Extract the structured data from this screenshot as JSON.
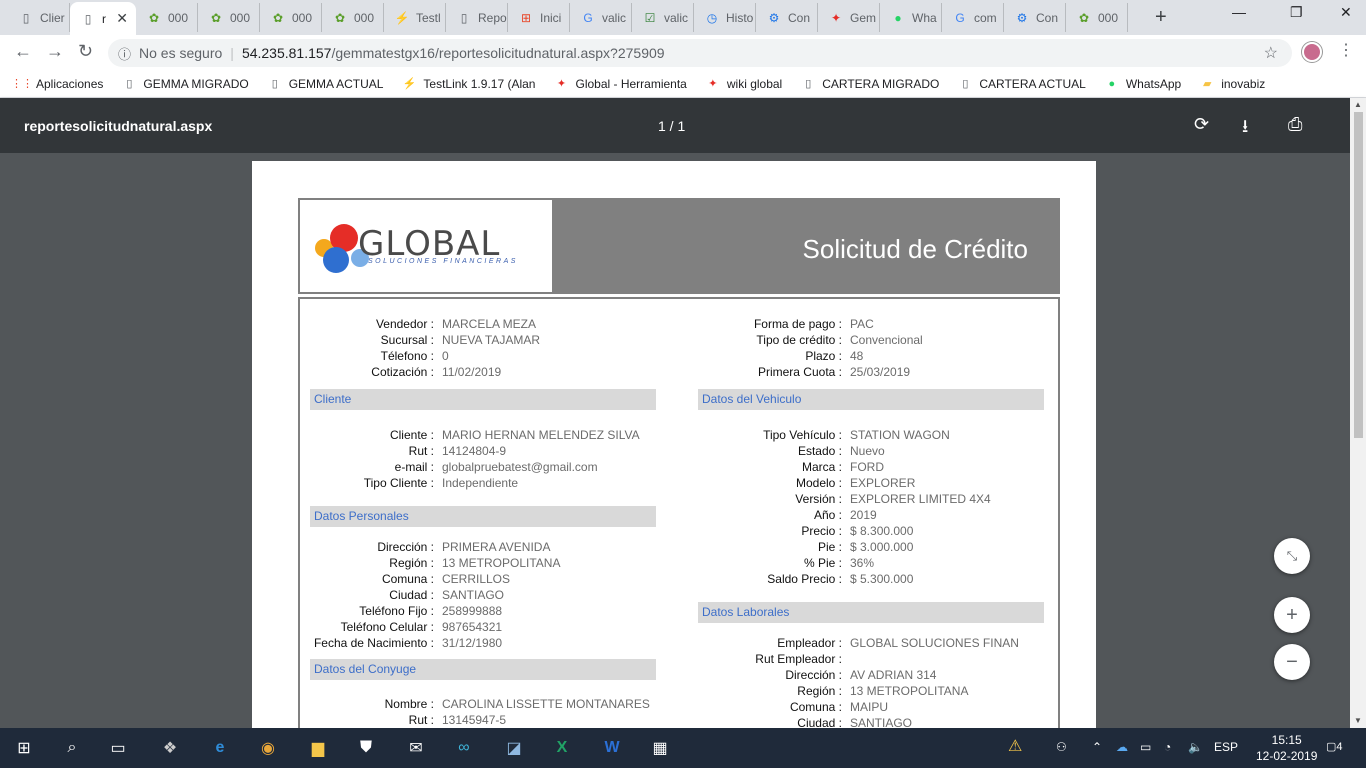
{
  "tabs": [
    {
      "label": "Clier",
      "icon": "page-icon"
    },
    {
      "label": "r",
      "icon": "page-icon",
      "active": true
    },
    {
      "label": "000",
      "icon": "gemma-icon"
    },
    {
      "label": "000",
      "icon": "gemma-icon"
    },
    {
      "label": "000",
      "icon": "gemma-icon"
    },
    {
      "label": "000",
      "icon": "gemma-icon"
    },
    {
      "label": "Testl",
      "icon": "testlink-icon"
    },
    {
      "label": "Repo",
      "icon": "page-icon"
    },
    {
      "label": "Inici",
      "icon": "windows-icon"
    },
    {
      "label": "valic",
      "icon": "google-icon"
    },
    {
      "label": "valic",
      "icon": "check-icon"
    },
    {
      "label": "Histo",
      "icon": "history-icon"
    },
    {
      "label": "Con",
      "icon": "gear-icon"
    },
    {
      "label": "Gem",
      "icon": "global-icon"
    },
    {
      "label": "Wha",
      "icon": "whatsapp-icon"
    },
    {
      "label": "com",
      "icon": "google-icon"
    },
    {
      "label": "Con",
      "icon": "gear-icon"
    },
    {
      "label": "000",
      "icon": "gemma-icon"
    }
  ],
  "address": {
    "security": "No es seguro",
    "host": "54.235.81.157",
    "path": "/gemmatestgx16/reportesolicitudnatural.aspx?275909"
  },
  "bookmarks": [
    {
      "label": "Aplicaciones",
      "icon": "apps-grid-icon"
    },
    {
      "label": "GEMMA MIGRADO",
      "icon": "page-icon"
    },
    {
      "label": "GEMMA ACTUAL",
      "icon": "page-icon"
    },
    {
      "label": "TestLink 1.9.17 (Alan",
      "icon": "testlink-icon"
    },
    {
      "label": "Global - Herramienta",
      "icon": "global-icon"
    },
    {
      "label": "wiki global",
      "icon": "global-icon"
    },
    {
      "label": "CARTERA MIGRADO",
      "icon": "page-icon"
    },
    {
      "label": "CARTERA ACTUAL",
      "icon": "page-icon"
    },
    {
      "label": "WhatsApp",
      "icon": "whatsapp-icon"
    },
    {
      "label": "inovabiz",
      "icon": "folder-icon"
    }
  ],
  "pdf": {
    "filename": "reportesolicitudnatural.aspx",
    "page_indicator": "1  /  1"
  },
  "doc": {
    "logo_word": "GLOBAL",
    "logo_sub": "SOLUCIONES FINANCIERAS",
    "title": "Solicitud de Crédito",
    "top_left": [
      {
        "label": "Vendedor :",
        "value": "MARCELA MEZA"
      },
      {
        "label": "Sucursal :",
        "value": "NUEVA TAJAMAR"
      },
      {
        "label": "Télefono :",
        "value": "0"
      },
      {
        "label": "Cotización :",
        "value": "11/02/2019"
      }
    ],
    "top_right": [
      {
        "label": "Forma de pago :",
        "value": "PAC"
      },
      {
        "label": "Tipo de crédito :",
        "value": "Convencional"
      },
      {
        "label": "Plazo :",
        "value": "48"
      },
      {
        "label": "Primera Cuota :",
        "value": "25/03/2019"
      }
    ],
    "sections": {
      "cliente": "Cliente",
      "personales": "Datos Personales",
      "conyuge": "Datos del Conyuge",
      "vehiculo": "Datos del Vehiculo",
      "laborales": "Datos Laborales"
    },
    "cliente": [
      {
        "label": "Cliente :",
        "value": "MARIO HERNAN MELENDEZ SILVA"
      },
      {
        "label": "Rut :",
        "value": "14124804-9"
      },
      {
        "label": "e-mail :",
        "value": "globalpruebatest@gmail.com"
      },
      {
        "label": "Tipo Cliente :",
        "value": "Independiente"
      }
    ],
    "personales": [
      {
        "label": "Dirección :",
        "value": "PRIMERA AVENIDA"
      },
      {
        "label": "Región :",
        "value": "13 METROPOLITANA"
      },
      {
        "label": "Comuna :",
        "value": "CERRILLOS"
      },
      {
        "label": "Ciudad :",
        "value": "SANTIAGO"
      },
      {
        "label": "Teléfono Fijo :",
        "value": "258999888"
      },
      {
        "label": "Teléfono Celular :",
        "value": "987654321"
      },
      {
        "label": "Fecha de Nacimiento :",
        "value": "31/12/1980"
      }
    ],
    "conyuge": [
      {
        "label": "Nombre :",
        "value": "CAROLINA LISSETTE MONTANARES"
      },
      {
        "label": "Rut :",
        "value": "13145947-5"
      }
    ],
    "vehiculo": [
      {
        "label": "Tipo Vehículo :",
        "value": "STATION WAGON"
      },
      {
        "label": "Estado :",
        "value": "Nuevo"
      },
      {
        "label": "Marca :",
        "value": "FORD"
      },
      {
        "label": "Modelo :",
        "value": "EXPLORER"
      },
      {
        "label": "Versión :",
        "value": "EXPLORER LIMITED 4X4"
      },
      {
        "label": "Año :",
        "value": "2019"
      },
      {
        "label": "Precio :",
        "value": "$ 8.300.000"
      },
      {
        "label": "Pie :",
        "value": "$ 3.000.000"
      },
      {
        "label": "% Pie :",
        "value": "36%"
      },
      {
        "label": "Saldo Precio :",
        "value": "$ 5.300.000"
      }
    ],
    "laborales": [
      {
        "label": "Empleador :",
        "value": "GLOBAL SOLUCIONES FINAN"
      },
      {
        "label": "Rut Empleador :",
        "value": ""
      },
      {
        "label": "Dirección :",
        "value": "AV ADRIAN 314"
      },
      {
        "label": "Región :",
        "value": "13 METROPOLITANA"
      },
      {
        "label": "Comuna :",
        "value": "MAIPU"
      },
      {
        "label": "Ciudad :",
        "value": "SANTIAGO"
      }
    ]
  },
  "taskbar": {
    "lang": "ESP",
    "time": "15:15",
    "date": "12-02-2019",
    "notifications": "4"
  }
}
